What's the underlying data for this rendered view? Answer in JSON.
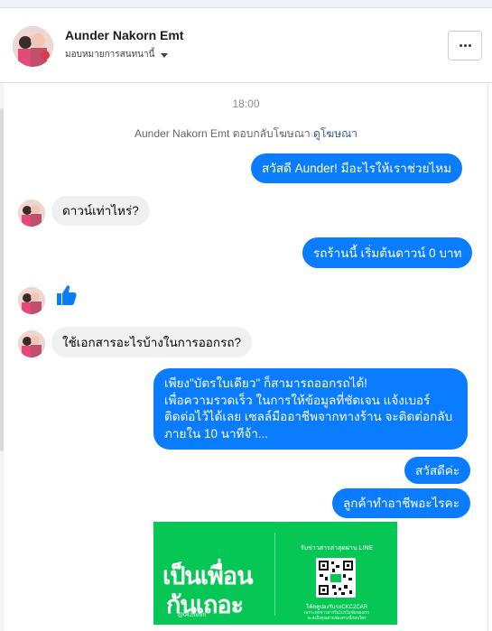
{
  "header": {
    "name": "Aunder Nakorn Emt",
    "assign_label": "มอบหมายการสนทนานี้"
  },
  "thread": {
    "time": "18:00",
    "notice_text": "Aunder Nakorn Emt ตอบกลับโฆษณา",
    "notice_link": "ดูโฆษณา",
    "msg_out_1": "สวัสดี Aunder! มีอะไรให้เราช่วยไหม",
    "msg_in_1": "ดาวน์เท่าไหร่?",
    "msg_out_2": "รถร้านนี้ เริ่มต้นดาวน์ 0 บาท",
    "msg_in_2": "ใช้เอกสารอะไรบ้างในการออกรถ?",
    "msg_out_3": "เพียง\"บัตรใบเดียว\" ก็สามารถออกรถได้!\nเพื่อความรวดเร็ว ในการให้ข้อมูลที่ชัดเจน แจ้งเบอร์\nติดต่อไว้ได้เลย เซลล์มืออาชีพจากทางร้าน จะติดต่อกลับ\nภายใน 10 นาทีจ้า...",
    "msg_out_4": "สวัสดีค่ะ",
    "msg_out_5": "ลูกค้าทำอาชีพอะไรคะ"
  },
  "promo": {
    "line1": "เป็นเพื่อน",
    "line2": "กันเถอะ",
    "handle": "@042fnmrh",
    "caption": "รับข่าวสารล่าสุดผ่าน LINE",
    "qr_id": "โค้ดคูปองรับรถCKC2CAR",
    "fine_print": "เพราะทุกข่าวสารในโปรโมชั่นของเรา\nจะส่งถึงคุณผ่านช่องทางนี้ก่อนใคร"
  },
  "colors": {
    "outgoing_bubble": "#0a7cff",
    "incoming_bubble": "#f0f0f0",
    "like_icon": "#0a7cff",
    "promo_background": "#06c755"
  },
  "icons": [
    "profile-avatar",
    "chevron-down-icon",
    "more-options-icon",
    "thumbs-up-icon",
    "qr-code"
  ]
}
